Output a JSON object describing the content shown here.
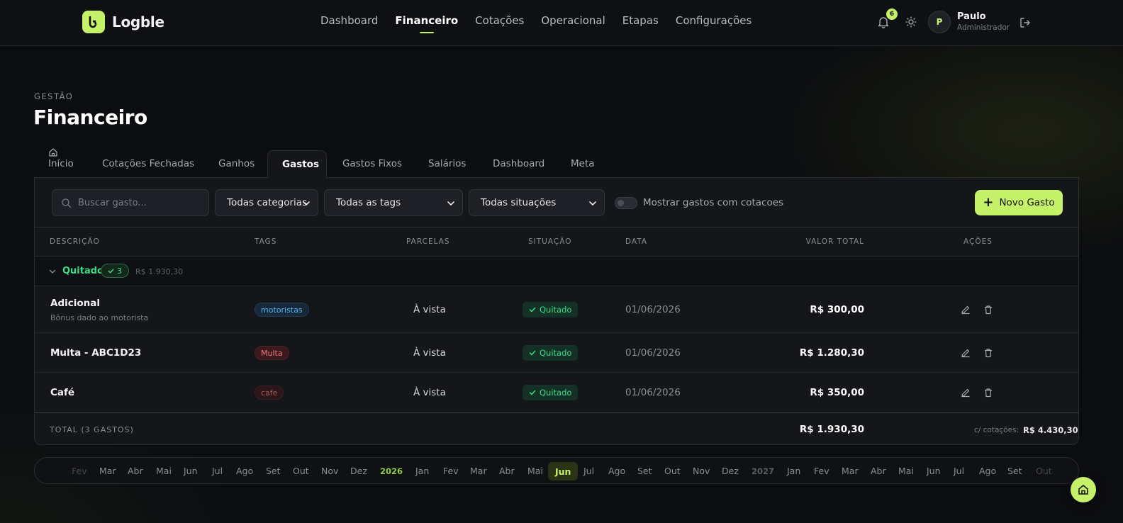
{
  "app": {
    "name": "Logble",
    "accent": "#c6f26a"
  },
  "nav": [
    "Dashboard",
    "Financeiro",
    "Cotações",
    "Operacional",
    "Etapas",
    "Configurações"
  ],
  "notifications": {
    "count": "6"
  },
  "user": {
    "initial": "P",
    "name": "Paulo",
    "role": "Administrador"
  },
  "page": {
    "eyebrow": "GESTÃO",
    "title": "Financeiro"
  },
  "tabs": [
    "Início",
    "Cotações Fechadas",
    "Ganhos",
    "Gastos",
    "Gastos Fixos",
    "Salários",
    "Dashboard",
    "Meta"
  ],
  "toolbar": {
    "search_placeholder": "Buscar gasto...",
    "category_filter": "Todas categorias",
    "tag_filter": "Todas as tags",
    "status_filter": "Todas situações",
    "toggle_label": "Mostrar gastos com cotacoes",
    "new_button": "Novo Gasto"
  },
  "table": {
    "columns": [
      "DESCRIÇÃO",
      "TAGS",
      "PARCELAS",
      "SITUAÇÃO",
      "DATA",
      "VALOR TOTAL",
      "AÇÕES"
    ],
    "group": {
      "label": "Quitado",
      "count": "3",
      "total": "R$ 1.930,30"
    },
    "rows": [
      {
        "description": "Adicional",
        "subtitle": "Bônus dado ao motorista",
        "tag": "motoristas",
        "tag_color": "blue",
        "installments": "À vista",
        "status": "Quitado",
        "date": "01/06/2026",
        "value": "R$ 300,00"
      },
      {
        "description": "Multa - ABC1D23",
        "subtitle": "",
        "tag": "Multa",
        "tag_color": "red",
        "installments": "À vista",
        "status": "Quitado",
        "date": "01/06/2026",
        "value": "R$ 1.280,30"
      },
      {
        "description": "Café",
        "subtitle": "",
        "tag": "cafe",
        "tag_color": "darkred",
        "installments": "À vista",
        "status": "Quitado",
        "date": "01/06/2026",
        "value": "R$ 350,00"
      }
    ],
    "footer": {
      "label": "TOTAL (3 GASTOS)",
      "total": "R$ 1.930,30",
      "with_quotes_label": "c/ cotações:",
      "with_quotes_value": "R$ 4.430,30"
    }
  },
  "timeline": {
    "months": [
      "Fev",
      "Mar",
      "Abr",
      "Mai",
      "Jun",
      "Jul",
      "Ago",
      "Set",
      "Out",
      "Nov",
      "Dez"
    ],
    "year_2026": "2026",
    "months_2026": [
      "Jan",
      "Fev",
      "Mar",
      "Abr",
      "Mai",
      "Jun",
      "Jul",
      "Ago",
      "Set",
      "Out",
      "Nov",
      "Dez"
    ],
    "year_2027": "2027",
    "months_2027": [
      "Jan",
      "Fev",
      "Mar",
      "Abr",
      "Mai",
      "Jun",
      "Jul",
      "Ago",
      "Set",
      "Out"
    ],
    "current": "Jun"
  }
}
